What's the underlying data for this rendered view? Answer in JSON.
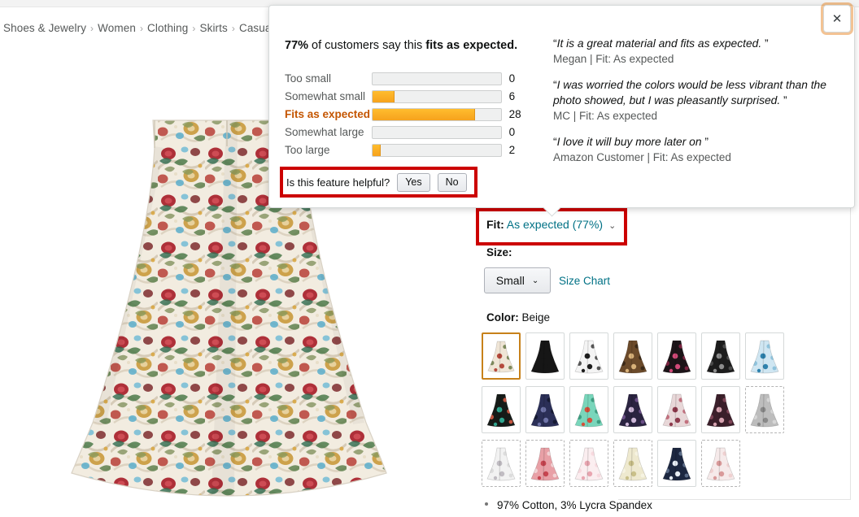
{
  "breadcrumb": {
    "items": [
      "Shoes & Jewelry",
      "Women",
      "Clothing",
      "Skirts",
      "Casual"
    ],
    "separator": "›"
  },
  "modal": {
    "close_label": "✕",
    "headline_pre": "77%",
    "headline_mid": " of customers say this ",
    "headline_post": "fits as expected.",
    "chart_data": {
      "type": "bar",
      "title": "77% of customers say this fits as expected.",
      "orientation": "horizontal",
      "categories": [
        "Too small",
        "Somewhat small",
        "Fits as expected",
        "Somewhat large",
        "Too large"
      ],
      "values": [
        0,
        6,
        28,
        0,
        2
      ],
      "highlighted_category": "Fits as expected",
      "max_track_value": 35,
      "bar_color": "#f6a21d",
      "track_color": "#eff0f0",
      "xlabel": "",
      "ylabel": "",
      "grid": false,
      "legend": "none"
    },
    "helpful": {
      "question": "Is this feature helpful?",
      "yes_label": "Yes",
      "no_label": "No"
    },
    "reviews": [
      {
        "quote": "It is a great material and fits as expected.",
        "attribution": "Megan | Fit: As expected"
      },
      {
        "quote": "I was worried the colors would be less vibrant than the photo showed, but I was pleasantly surprised.",
        "attribution": "MC | Fit: As expected"
      },
      {
        "quote": "I love it will buy more later on",
        "attribution": "Amazon Customer | Fit: As expected"
      }
    ]
  },
  "product": {
    "fit": {
      "label": "Fit:",
      "value": "As expected (77%)",
      "caret": "⌄"
    },
    "size": {
      "label": "Size:",
      "selected": "Small",
      "caret": "⌄",
      "size_chart_link": "Size Chart"
    },
    "color": {
      "label": "Color:",
      "value": "Beige",
      "swatches": [
        {
          "name": "beige-floral",
          "selected": true,
          "dashed": false,
          "base": "#efe5d6",
          "accent": "#b5493c",
          "accent2": "#7d8a5c"
        },
        {
          "name": "black-solid",
          "selected": false,
          "dashed": false,
          "base": "#161616",
          "accent": "#161616",
          "accent2": "#161616"
        },
        {
          "name": "white-black-floral",
          "selected": false,
          "dashed": false,
          "base": "#f4f4f4",
          "accent": "#1d1d1d",
          "accent2": "#555555"
        },
        {
          "name": "brown-floral",
          "selected": false,
          "dashed": false,
          "base": "#6b4a2a",
          "accent": "#d9b27a",
          "accent2": "#3c2a18"
        },
        {
          "name": "black-pink-floral",
          "selected": false,
          "dashed": false,
          "base": "#1c1418",
          "accent": "#d14a79",
          "accent2": "#7a2340"
        },
        {
          "name": "black-gray-floral",
          "selected": false,
          "dashed": false,
          "base": "#1d1d1d",
          "accent": "#8e8e8e",
          "accent2": "#4a4a4a"
        },
        {
          "name": "light-blue-floral",
          "selected": false,
          "dashed": false,
          "base": "#cfe6f2",
          "accent": "#2e82ad",
          "accent2": "#8fc3dc"
        },
        {
          "name": "black-teal-floral",
          "selected": false,
          "dashed": false,
          "base": "#161b18",
          "accent": "#2fa68f",
          "accent2": "#c4553f"
        },
        {
          "name": "navy-floral",
          "selected": false,
          "dashed": false,
          "base": "#2b2f57",
          "accent": "#6f74a8",
          "accent2": "#161a33"
        },
        {
          "name": "mint-floral",
          "selected": false,
          "dashed": false,
          "base": "#79d6bb",
          "accent": "#d4503c",
          "accent2": "#3f9e82"
        },
        {
          "name": "dark-purple-floral",
          "selected": false,
          "dashed": false,
          "base": "#2a2340",
          "accent": "#cdb7d8",
          "accent2": "#6a4f86"
        },
        {
          "name": "pink-rose-floral",
          "selected": false,
          "dashed": false,
          "base": "#e8d7d8",
          "accent": "#8d3a4c",
          "accent2": "#c2707e"
        },
        {
          "name": "maroon-floral",
          "selected": false,
          "dashed": false,
          "base": "#3b1f2a",
          "accent": "#d7a3b0",
          "accent2": "#7e4456"
        },
        {
          "name": "gray-floral",
          "selected": false,
          "dashed": true,
          "base": "#bdbdbd",
          "accent": "#8a8a8a",
          "accent2": "#d6d6d6"
        },
        {
          "name": "white-gray-floral",
          "selected": false,
          "dashed": true,
          "base": "#f2f2f2",
          "accent": "#c0bcc2",
          "accent2": "#dcdcdc"
        },
        {
          "name": "red-rose-floral",
          "selected": false,
          "dashed": true,
          "base": "#e8a0a6",
          "accent": "#c74550",
          "accent2": "#f2d3d5"
        },
        {
          "name": "pale-pink-floral",
          "selected": false,
          "dashed": true,
          "base": "#fbeef0",
          "accent": "#e9a6b1",
          "accent2": "#f7d9de"
        },
        {
          "name": "cream-floral",
          "selected": false,
          "dashed": true,
          "base": "#eee9cf",
          "accent": "#c9c089",
          "accent2": "#f6f3e2"
        },
        {
          "name": "navy-white-floral",
          "selected": false,
          "dashed": false,
          "base": "#1c2740",
          "accent": "#e8eef5",
          "accent2": "#5a6b87"
        },
        {
          "name": "blush-floral",
          "selected": false,
          "dashed": true,
          "base": "#f6eaea",
          "accent": "#d99a9a",
          "accent2": "#efd0d0"
        }
      ]
    },
    "bullets": [
      "97% Cotton, 3% Lycra Spandex"
    ]
  }
}
